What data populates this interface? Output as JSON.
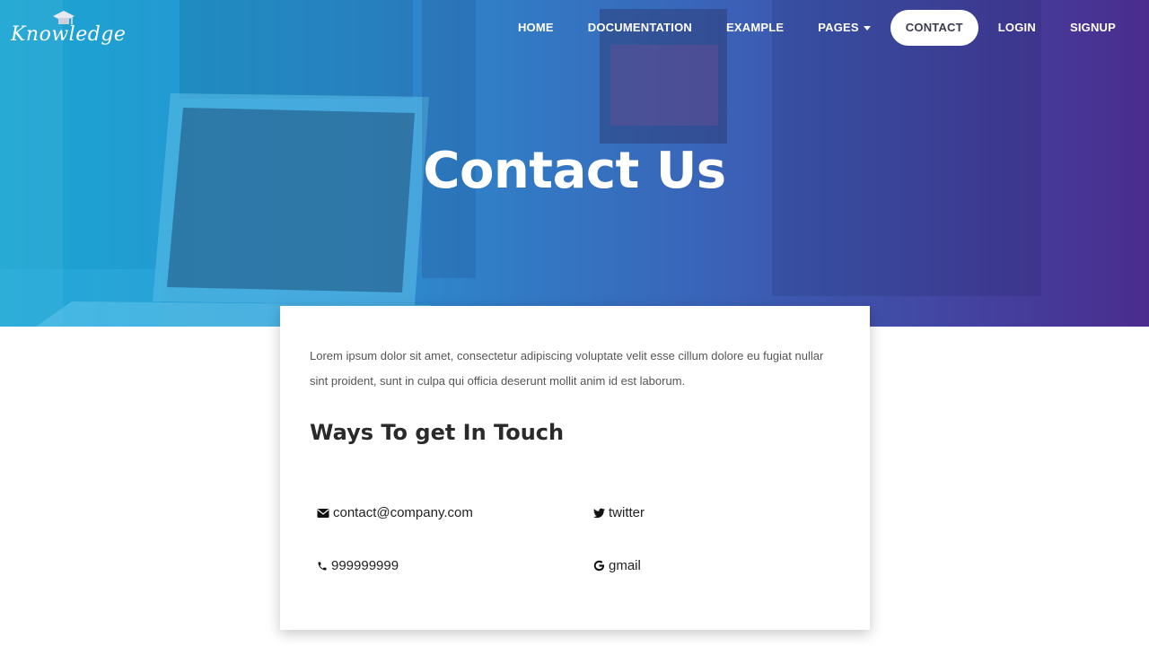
{
  "brand": {
    "logo_text": "Knowledge"
  },
  "nav": {
    "items": [
      {
        "label": "HOME"
      },
      {
        "label": "DOCUMENTATION"
      },
      {
        "label": "EXAMPLE"
      },
      {
        "label": "PAGES"
      },
      {
        "label": "CONTACT"
      },
      {
        "label": "LOGIN"
      },
      {
        "label": "SIGNUP"
      }
    ],
    "active": "CONTACT"
  },
  "hero": {
    "title": "Contact Us",
    "gradient_start": "#1aa6d3",
    "gradient_end": "#4a2c8e"
  },
  "content": {
    "intro": "Lorem ipsum dolor sit amet, consectetur adipiscing voluptate velit esse cillum dolore eu fugiat nullar sint proident, sunt in culpa qui officia deserunt mollit anim id est laborum.",
    "section_title": "Ways To get In Touch",
    "contacts": {
      "email": {
        "icon": "envelope-icon",
        "text": "contact@company.com"
      },
      "twitter": {
        "icon": "twitter-icon",
        "text": "twitter"
      },
      "phone": {
        "icon": "phone-icon",
        "text": "999999999"
      },
      "gmail": {
        "icon": "google-icon",
        "text": "gmail"
      }
    }
  }
}
